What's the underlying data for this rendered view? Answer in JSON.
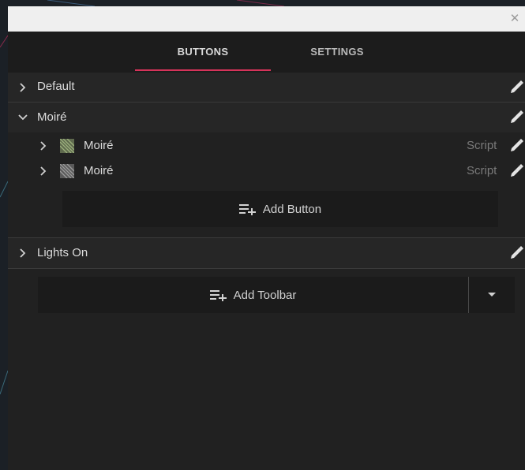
{
  "window": {
    "close_glyph": "✕"
  },
  "tabs": [
    {
      "label": "BUTTONS",
      "active": true
    },
    {
      "label": "SETTINGS",
      "active": false
    }
  ],
  "groups": [
    {
      "label": "Default",
      "expanded": false
    },
    {
      "label": "Moiré",
      "expanded": true,
      "items": [
        {
          "label": "Moiré",
          "tag": "Script"
        },
        {
          "label": "Moiré",
          "tag": "Script"
        }
      ],
      "add_button_label": "Add Button"
    },
    {
      "label": "Lights On",
      "expanded": false
    }
  ],
  "add_toolbar_label": "Add Toolbar",
  "colors": {
    "accent": "#d6335a",
    "panel": "#212121",
    "row": "#262626",
    "button": "#1b1b1b"
  },
  "icons": [
    "close-icon",
    "chevron-right-icon",
    "chevron-down-icon",
    "pencil-icon",
    "playlist-add-icon",
    "caret-down-icon",
    "moire-thumbnail-icon"
  ]
}
